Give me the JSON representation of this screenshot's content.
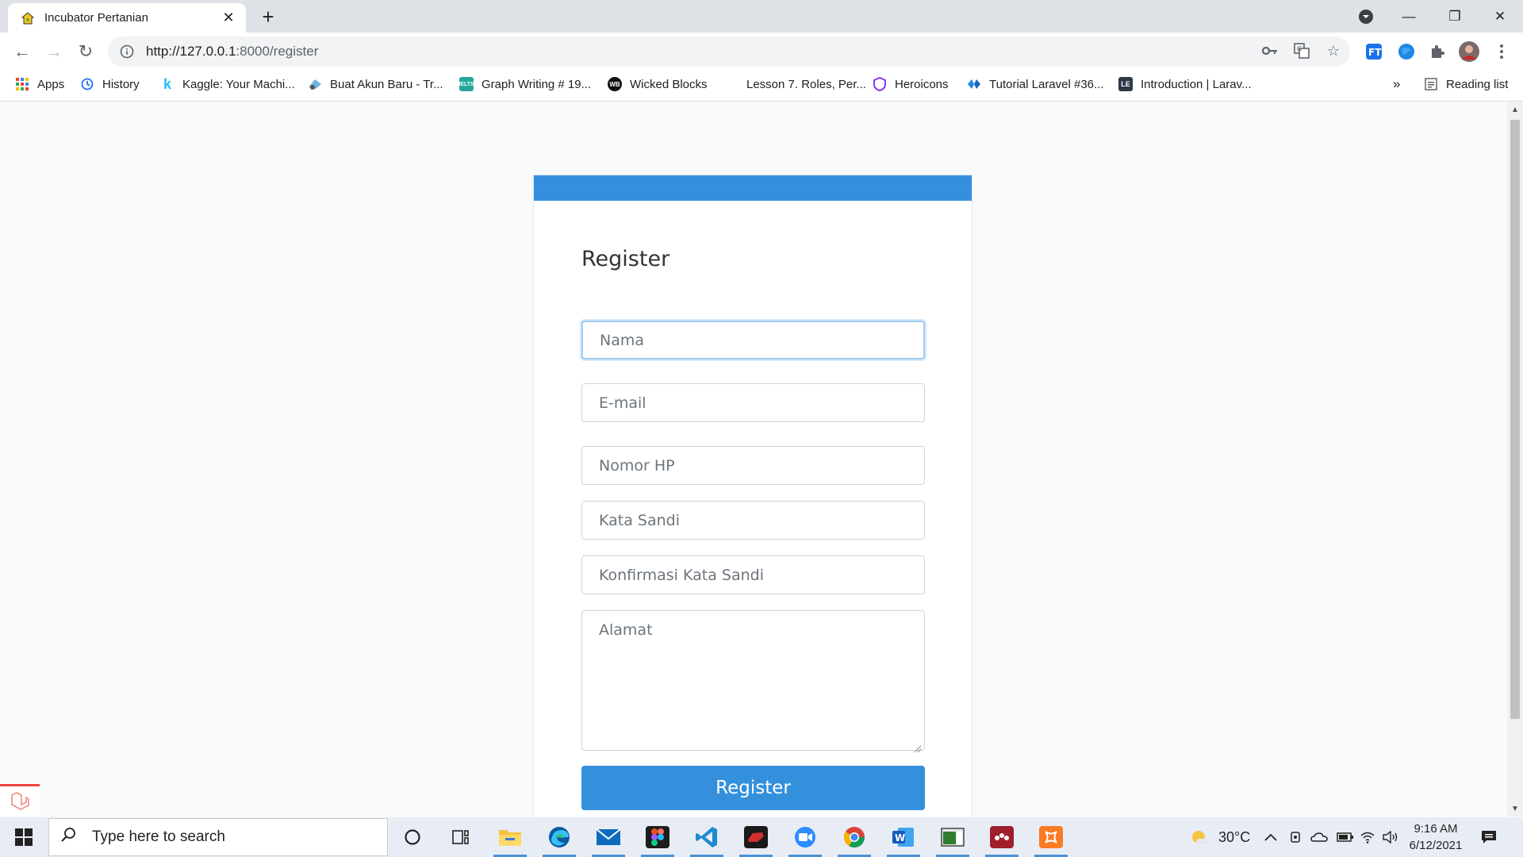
{
  "browser": {
    "tab_title": "Incubator Pertanian",
    "tab_close": "✕",
    "new_tab": "+",
    "url_host": "http://127.0.0.1",
    "url_path": ":8000/register",
    "window": {
      "minimize": "—",
      "restore": "❐",
      "close": "✕"
    }
  },
  "bookmarks": {
    "items": [
      {
        "label": "Apps",
        "icon": "apps-grid-icon"
      },
      {
        "label": "History",
        "icon": "history-icon"
      },
      {
        "label": "Kaggle: Your Machi...",
        "icon": "kaggle-icon"
      },
      {
        "label": "Buat Akun Baru - Tr...",
        "icon": "traveloka-icon"
      },
      {
        "label": "Graph Writing # 19...",
        "icon": "ielts-icon"
      },
      {
        "label": "Wicked Blocks",
        "icon": "wicked-blocks-icon"
      },
      {
        "label": "Lesson 7. Roles, Per...",
        "icon": "blank-icon"
      },
      {
        "label": "Heroicons",
        "icon": "heroicons-icon"
      },
      {
        "label": "Tutorial Laravel #36...",
        "icon": "diamond-icon"
      },
      {
        "label": "Introduction | Larav...",
        "icon": "le-icon"
      }
    ],
    "overflow": "»",
    "reading_list": "Reading list"
  },
  "form": {
    "title": "Register",
    "nama_placeholder": "Nama",
    "email_placeholder": "E-mail",
    "hp_placeholder": "Nomor HP",
    "password_placeholder": "Kata Sandi",
    "confirm_placeholder": "Konfirmasi Kata Sandi",
    "alamat_placeholder": "Alamat",
    "submit_label": "Register",
    "accent_color": "#3490dc"
  },
  "taskbar": {
    "search_placeholder": "Type here to search",
    "weather": "30°C",
    "time": "9:16 AM",
    "date": "6/12/2021"
  }
}
